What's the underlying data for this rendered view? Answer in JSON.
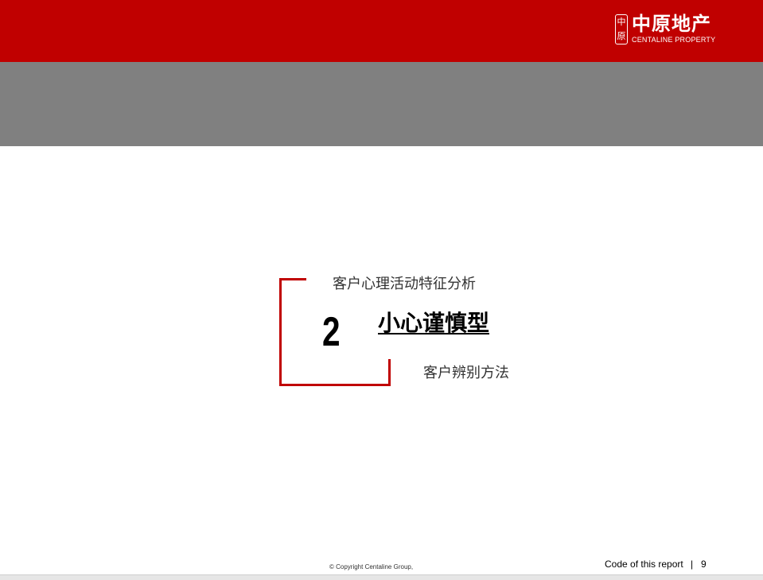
{
  "logo": {
    "seal_text_top": "中",
    "seal_text_bottom": "原",
    "chinese_name": "中原地产",
    "english_name": "CENTALINE PROPERTY"
  },
  "section": {
    "previous_title": "客户心理活动特征分析",
    "number": "2",
    "title": "小心谨慎型",
    "next_title": "客户辨别方法"
  },
  "footer": {
    "copyright": "© Copyright  Centaline Group,",
    "report_code": "Code of this report",
    "separator": "|",
    "page_number": "9"
  },
  "colors": {
    "brand_red": "#c00000",
    "band_gray": "#808080"
  }
}
